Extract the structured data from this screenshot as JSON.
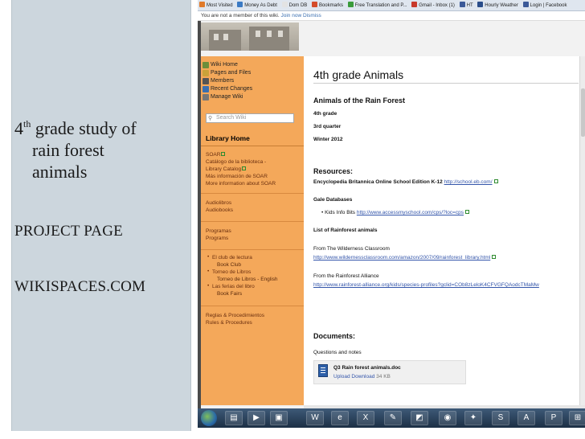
{
  "slide": {
    "title_num": "4",
    "title_sup": "th",
    "title_rest": " grade study of",
    "title_line2": "rain forest",
    "title_line3": "animals",
    "project": "PROJECT PAGE",
    "site": "WIKISPACES.COM"
  },
  "bookmarks": [
    {
      "label": "Most Visited",
      "color": "#e07a2a"
    },
    {
      "label": "Money As Debt",
      "color": "#3b7ac4"
    },
    {
      "label": "Dom DB",
      "color": "#e3e3e3"
    },
    {
      "label": "Bookmarks",
      "color": "#d44b2a"
    },
    {
      "label": "Free Translation and P...",
      "color": "#3a9b3a"
    },
    {
      "label": "Gmail - Inbox (1)",
      "color": "#c8392b"
    },
    {
      "label": "HT",
      "color": "#3b5998"
    },
    {
      "label": "Hourly Weather",
      "color": "#2a4d8a"
    },
    {
      "label": "Login | Facebook",
      "color": "#3b5998"
    }
  ],
  "notice": {
    "text": "You are not a member of this wiki.",
    "join": "Join now",
    "dismiss": "Dismiss"
  },
  "wiki_nav": {
    "items": [
      {
        "label": "Wiki Home",
        "color": "#6c8e3a"
      },
      {
        "label": "Pages and Files",
        "color": "#c9a23a"
      },
      {
        "label": "Members",
        "color": "#555"
      },
      {
        "label": "Recent Changes",
        "color": "#3a6fb0"
      },
      {
        "label": "Manage Wiki",
        "color": "#777"
      }
    ],
    "search_placeholder": "Search Wiki",
    "library_home": "Library Home",
    "links": [
      {
        "text": "SOAR",
        "ext": true
      },
      {
        "text": "Catálogo de la biblioteca -",
        "ext": false
      },
      {
        "text": "Library Catalog",
        "ext": true
      },
      {
        "text": "Más información de SOAR",
        "ext": false
      },
      {
        "text": "More information about SOAR",
        "ext": false
      },
      {
        "text": "Audiolibros",
        "ext": false
      },
      {
        "text": "Audiobooks",
        "ext": false
      },
      {
        "text": "Programas",
        "ext": false
      },
      {
        "text": "Programs",
        "ext": false
      },
      {
        "text": "El club de lectura",
        "ext": false
      },
      {
        "text": "Book Club",
        "ext": false
      },
      {
        "text": "Torneo de Libros",
        "ext": false
      },
      {
        "text": "Torneo de Libros - English",
        "ext": false
      },
      {
        "text": "Las ferias del libro",
        "ext": false
      },
      {
        "text": "Book Fairs",
        "ext": false
      },
      {
        "text": "Reglas & Procedimientos",
        "ext": false
      },
      {
        "text": "Rules & Procedures",
        "ext": false
      }
    ]
  },
  "page": {
    "title": "4th grade Animals",
    "heading": "Animals of the Rain Forest",
    "grade": "4th grade",
    "quarter": "3rd quarter",
    "term": "Winter 2012",
    "resources_heading": "Resources:",
    "eb_label": "Encyclopedia Britannica Online School Edition K-12",
    "eb_url": "http://school.eb.com/",
    "gale_label": "Gale Databases",
    "kids_label": "Kids Info Bits",
    "kids_url": "http://www.accessmyschool.com/cps/?loc=cps",
    "list_label": "List of Rainforest animals",
    "wild_label": "From The Wilderness Classroom",
    "wild_url": "http://www.wildernessclassroom.com/amazon/2007/09/rainforest_library.html",
    "alliance_label": "From the Rainforest Alliance",
    "alliance_url": "http://www.rainforest-alliance.org/kids/species-profiles?gclid=COb8zLeloK4CFVGFQAodcTMaMw",
    "docs_heading": "Documents:",
    "qn_label": "Questions and notes",
    "doc_name": "Q3 Rain forest animals.doc",
    "doc_upload": "Upload",
    "doc_download": "Download",
    "doc_size": "34 KB"
  },
  "taskbar": {
    "apps": [
      {
        "name": "explorer-icon",
        "glyph": "▤"
      },
      {
        "name": "media-player-icon",
        "glyph": "▶"
      },
      {
        "name": "folder-icon",
        "glyph": "▣"
      },
      {
        "name": "word-icon",
        "glyph": "W"
      },
      {
        "name": "internet-explorer-icon",
        "glyph": "e"
      },
      {
        "name": "excel-icon",
        "glyph": "X"
      },
      {
        "name": "paint-icon",
        "glyph": "✎"
      },
      {
        "name": "images-icon",
        "glyph": "◩"
      },
      {
        "name": "firefox-icon",
        "glyph": "◉"
      },
      {
        "name": "network-icon",
        "glyph": "✦"
      },
      {
        "name": "skype-icon",
        "glyph": "S"
      },
      {
        "name": "acrobat-icon",
        "glyph": "A"
      },
      {
        "name": "powerpoint-icon",
        "glyph": "P"
      },
      {
        "name": "windows-icon",
        "glyph": "⊞"
      }
    ]
  }
}
